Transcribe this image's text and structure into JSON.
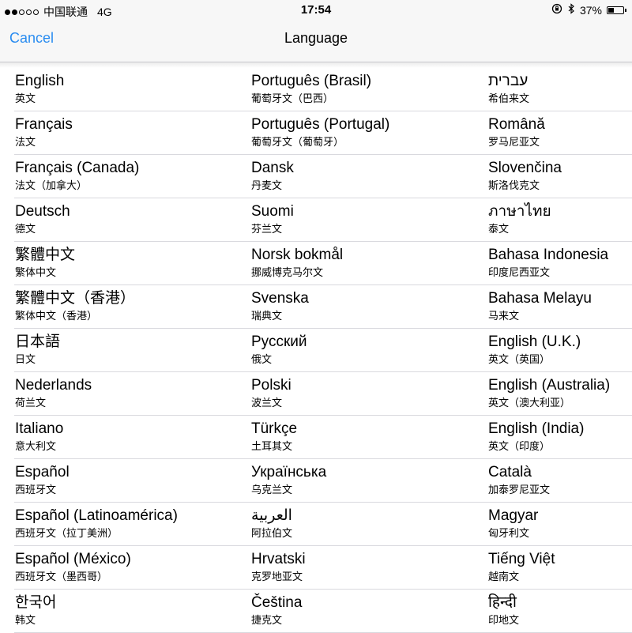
{
  "status_bar": {
    "carrier": "中国联通",
    "network": "4G",
    "time": "17:54",
    "battery_percent_text": "37%",
    "battery_level": 0.37,
    "icons": [
      "signal-dots-icon",
      "orientation-lock-icon",
      "bluetooth-icon",
      "battery-icon"
    ]
  },
  "nav": {
    "cancel_label": "Cancel",
    "title": "Language",
    "accent_color": "#2a8cf0"
  },
  "languages": [
    [
      {
        "native": "English",
        "local": "英文"
      },
      {
        "native": "Português (Brasil)",
        "local": "葡萄牙文（巴西）"
      },
      {
        "native": "עברית",
        "local": "希伯来文"
      }
    ],
    [
      {
        "native": "Français",
        "local": "法文"
      },
      {
        "native": "Português (Portugal)",
        "local": "葡萄牙文（葡萄牙）"
      },
      {
        "native": "Română",
        "local": "罗马尼亚文"
      }
    ],
    [
      {
        "native": "Français (Canada)",
        "local": "法文（加拿大）"
      },
      {
        "native": "Dansk",
        "local": "丹麦文"
      },
      {
        "native": "Slovenčina",
        "local": "斯洛伐克文"
      }
    ],
    [
      {
        "native": "Deutsch",
        "local": "德文"
      },
      {
        "native": "Suomi",
        "local": "芬兰文"
      },
      {
        "native": "ภาษาไทย",
        "local": "泰文"
      }
    ],
    [
      {
        "native": "繁體中文",
        "local": "繁体中文"
      },
      {
        "native": "Norsk bokmål",
        "local": "挪威博克马尔文"
      },
      {
        "native": "Bahasa Indonesia",
        "local": "印度尼西亚文"
      }
    ],
    [
      {
        "native": "繁體中文（香港）",
        "local": "繁体中文（香港）"
      },
      {
        "native": "Svenska",
        "local": "瑞典文"
      },
      {
        "native": "Bahasa Melayu",
        "local": "马来文"
      }
    ],
    [
      {
        "native": "日本語",
        "local": "日文"
      },
      {
        "native": "Русский",
        "local": "俄文"
      },
      {
        "native": "English (U.K.)",
        "local": "英文（英国）"
      }
    ],
    [
      {
        "native": "Nederlands",
        "local": "荷兰文"
      },
      {
        "native": "Polski",
        "local": "波兰文"
      },
      {
        "native": "English (Australia)",
        "local": "英文（澳大利亚）"
      }
    ],
    [
      {
        "native": "Italiano",
        "local": "意大利文"
      },
      {
        "native": "Türkçe",
        "local": "土耳其文"
      },
      {
        "native": "English (India)",
        "local": "英文（印度）"
      }
    ],
    [
      {
        "native": "Español",
        "local": "西班牙文"
      },
      {
        "native": "Українська",
        "local": "乌克兰文"
      },
      {
        "native": "Català",
        "local": "加泰罗尼亚文"
      }
    ],
    [
      {
        "native": "Español (Latinoamérica)",
        "local": "西班牙文（拉丁美洲）"
      },
      {
        "native": "العربية",
        "local": "阿拉伯文"
      },
      {
        "native": "Magyar",
        "local": "匈牙利文"
      }
    ],
    [
      {
        "native": "Español (México)",
        "local": "西班牙文（墨西哥）"
      },
      {
        "native": "Hrvatski",
        "local": "克罗地亚文"
      },
      {
        "native": "Tiếng Việt",
        "local": "越南文"
      }
    ],
    [
      {
        "native": "한국어",
        "local": "韩文"
      },
      {
        "native": "Čeština",
        "local": "捷克文"
      },
      {
        "native": "हिन्दी",
        "local": "印地文"
      }
    ]
  ]
}
